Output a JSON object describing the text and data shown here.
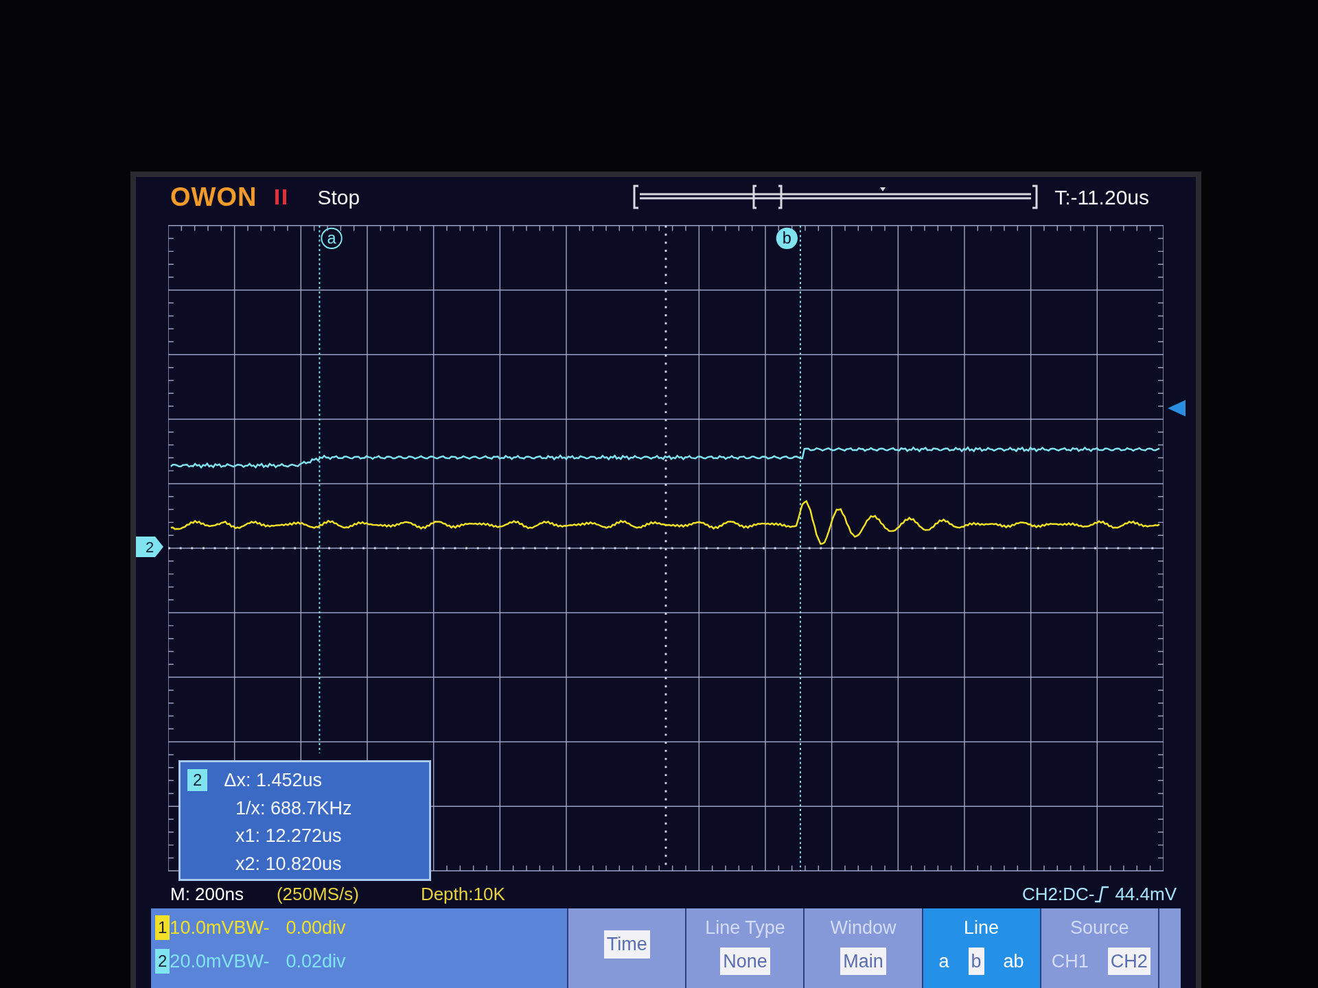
{
  "header": {
    "logo": "OWON",
    "status": "Stop",
    "trigger_time": "T:-11.20us"
  },
  "cursors": [
    {
      "label": "a"
    },
    {
      "label": "b"
    }
  ],
  "channel_marker": "2",
  "measurement": {
    "channel": "2",
    "lines": [
      "Δx: 1.452us",
      "1/x: 688.7KHz",
      "x1: 12.272us",
      "x2: 10.820us"
    ]
  },
  "status_bar": {
    "timebase": "M: 200ns",
    "sample_rate": "(250MS/s)",
    "depth": "Depth:10K",
    "trigger": "CH2:DC-",
    "trigger_level": "44.4mV"
  },
  "channels": [
    {
      "number": "1",
      "scale": "10.0mV",
      "bw": "BW-",
      "offset": "0.00div",
      "color": "#f2e028"
    },
    {
      "number": "2",
      "scale": "20.0mV",
      "bw": "BW-",
      "offset": "0.02div",
      "color": "#7fe3f0"
    }
  ],
  "menu": [
    {
      "kind": "button",
      "title": "Time",
      "active": false
    },
    {
      "kind": "options",
      "title": "Line Type",
      "active": false,
      "options": [
        {
          "label": "None",
          "selected": true
        }
      ]
    },
    {
      "kind": "options",
      "title": "Window",
      "active": false,
      "options": [
        {
          "label": "Main",
          "selected": true
        }
      ]
    },
    {
      "kind": "options",
      "title": "Line",
      "active": true,
      "options": [
        {
          "label": "a",
          "selected": false
        },
        {
          "label": "b",
          "selected": true
        },
        {
          "label": "ab",
          "selected": false
        }
      ]
    },
    {
      "kind": "options",
      "title": "Source",
      "active": false,
      "options": [
        {
          "label": "CH1",
          "selected": false
        },
        {
          "label": "CH2",
          "selected": true
        }
      ]
    }
  ]
}
